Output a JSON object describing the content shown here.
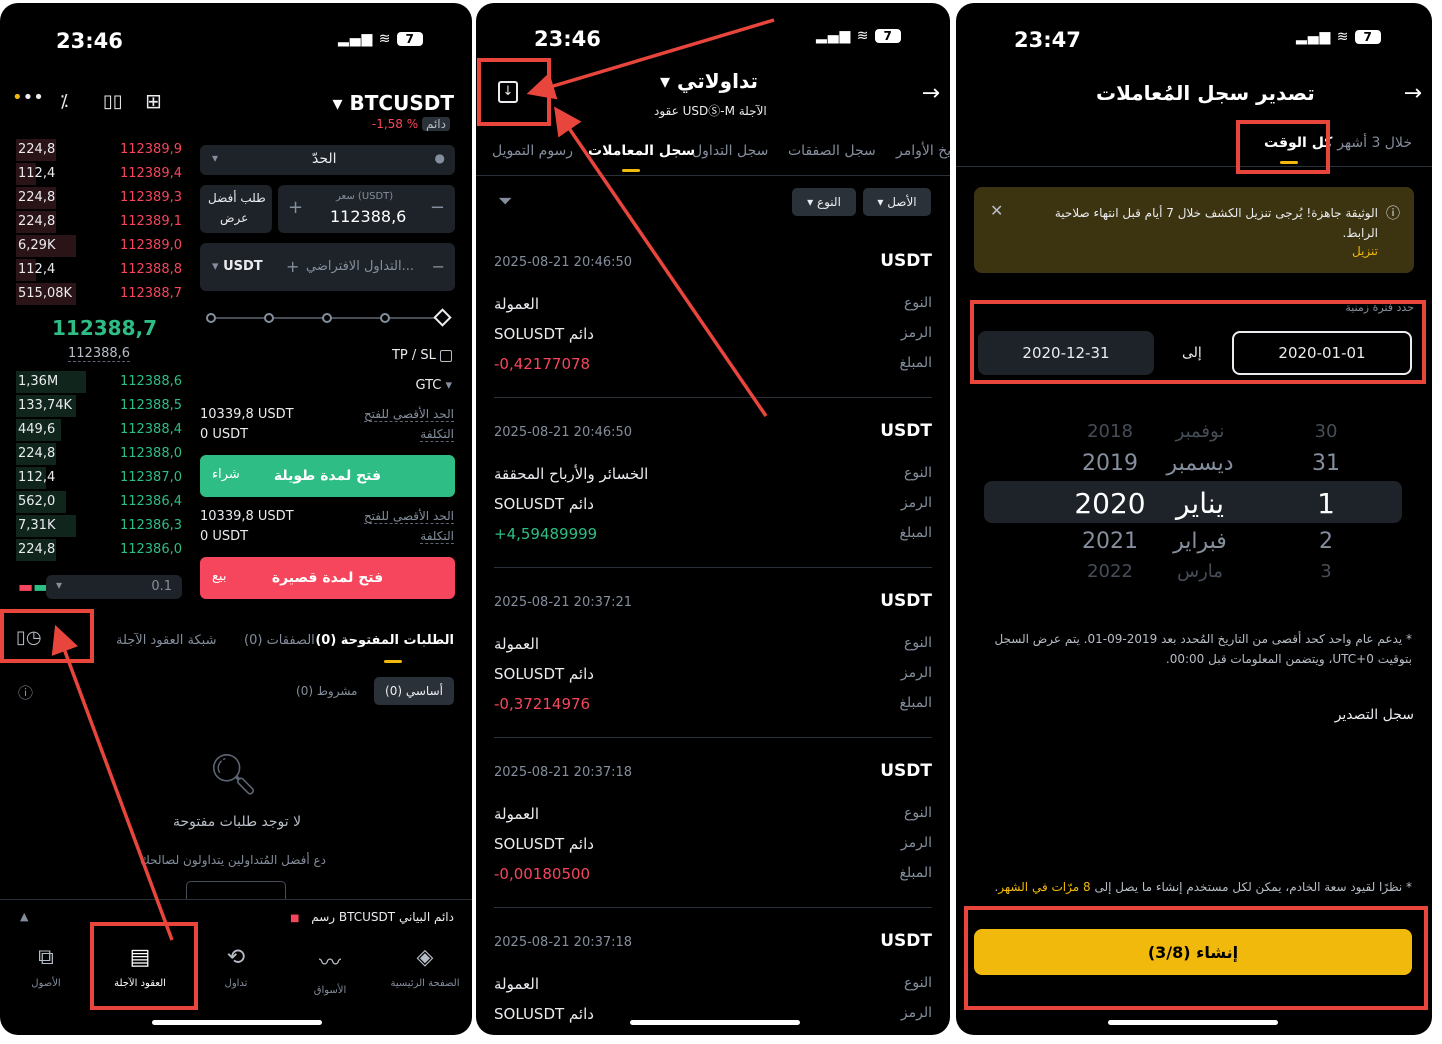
{
  "status": {
    "time1": "23:46",
    "time2": "23:46",
    "time3": "23:47",
    "battery": "7"
  },
  "p1": {
    "symbol": "BTCUSDT",
    "perp": "دائم",
    "change": "-1,58 %",
    "asks": [
      {
        "q": "224,8",
        "p": "112389,9"
      },
      {
        "q": "112,4",
        "p": "112389,4"
      },
      {
        "q": "224,8",
        "p": "112389,3"
      },
      {
        "q": "224,8",
        "p": "112389,1"
      },
      {
        "q": "6,29K",
        "p": "112389,0"
      },
      {
        "q": "112,4",
        "p": "112388,8"
      },
      {
        "q": "515,08K",
        "p": "112388,7"
      }
    ],
    "mid_price": "112388,7",
    "mark_price": "112388,6",
    "bids": [
      {
        "q": "1,36M",
        "p": "112388,6"
      },
      {
        "q": "133,74K",
        "p": "112388,5"
      },
      {
        "q": "449,6",
        "p": "112388,4"
      },
      {
        "q": "224,8",
        "p": "112388,0"
      },
      {
        "q": "112,4",
        "p": "112387,0"
      },
      {
        "q": "562,0",
        "p": "112386,4"
      },
      {
        "q": "7,31K",
        "p": "112386,3"
      },
      {
        "q": "224,8",
        "p": "112386,0"
      }
    ],
    "depth_step": "0.1",
    "order_type": "الحدّ",
    "bbo_top": "طلب أفضل",
    "bbo_bottom": "عرض",
    "price_label": "سعر (USDT)",
    "price_value": "112388,6",
    "amount_placeholder": "التداول الافتراضي...",
    "amount_unit": "USDT",
    "tpsl": "TP / SL",
    "gtc": "GTC",
    "max_open_label": "الحد الأقصى للفتح",
    "cost_label": "التكلفة",
    "max_open_long": "10339,8 USDT",
    "cost_long": "0 USDT",
    "long_btn": "فتح لمدة طويلة",
    "long_side": "شراء",
    "max_open_short": "10339,8 USDT",
    "cost_short": "0 USDT",
    "short_btn": "فتح لمدة قصيرة",
    "short_side": "بيع",
    "tabs": [
      "الطلبات المفتوحة (0)",
      "الصفقات (0)",
      "شبكة العقود الآجلة"
    ],
    "sub_basic": "أساسي (0)",
    "sub_cond": "مشروط (0)",
    "empty_title": "لا توجد طلبات مفتوحة",
    "empty_sub": "دع أفضل المُتداولين يتداولون لصالحك",
    "chart_bar": "رسم BTCUSDT دائم البياني",
    "nav": [
      "الأصول",
      "العقود الآجلة",
      "تداول",
      "الأسواق",
      "الصفحة الرئيسية"
    ]
  },
  "p2": {
    "title": "تداولاتي",
    "subtitle": "عقود USDⓈ-M الآجلة",
    "tabs": [
      "رسوم التمويل",
      "سجل المعاملات",
      "سجل التداول",
      "سجل الصفقات",
      "يخ الأوامر"
    ],
    "filter_asset": "الأصل",
    "filter_type": "النوع",
    "lbl_type": "النوع",
    "lbl_symbol": "الرمز",
    "lbl_amount": "المبلغ",
    "records": [
      {
        "date": "2025-08-21 20:46:50",
        "asset": "USDT",
        "type": "العمولة",
        "symbol": "SOLUSDT دائم",
        "amount": "-0,42177078",
        "pos": false
      },
      {
        "date": "2025-08-21 20:46:50",
        "asset": "USDT",
        "type": "الخسائر والأرباح المحققة",
        "symbol": "SOLUSDT دائم",
        "amount": "+4,59489999",
        "pos": true
      },
      {
        "date": "2025-08-21 20:37:21",
        "asset": "USDT",
        "type": "العمولة",
        "symbol": "SOLUSDT دائم",
        "amount": "-0,37214976",
        "pos": false
      },
      {
        "date": "2025-08-21 20:37:18",
        "asset": "USDT",
        "type": "العمولة",
        "symbol": "SOLUSDT دائم",
        "amount": "-0,00180500",
        "pos": false
      },
      {
        "date": "2025-08-21 20:37:18",
        "asset": "USDT",
        "type": "العمولة",
        "symbol": "SOLUSDT دائم",
        "amount": "",
        "pos": false
      }
    ]
  },
  "p3": {
    "title": "تصدير سجل المُعاملات",
    "tab_3m": "خلال 3 أشهر",
    "tab_all": "كل الوقت",
    "notice": "الوثيقة جاهزة! يُرجى تنزيل الكشف خلال 7 أيام قبل انتهاء صلاحية الرابط.",
    "notice_link": "تنزيل",
    "range_label": "حدد فترة زمنية",
    "from": "2020-01-01",
    "to_word": "إلى",
    "to": "2020-12-31",
    "picker": [
      {
        "y": "2018",
        "m": "نوفمبر",
        "d": "30"
      },
      {
        "y": "2019",
        "m": "ديسمبر",
        "d": "31"
      },
      {
        "y": "2020",
        "m": "يناير",
        "d": "1"
      },
      {
        "y": "2021",
        "m": "فبراير",
        "d": "2"
      },
      {
        "y": "2022",
        "m": "مارس",
        "d": "3"
      }
    ],
    "note": "* يدعم عام واحد كحد أقصى من التاريخ المُحدد بعد 2019-09-01. يتم عرض السجل بتوقيت UTC+0، ويتضمن المعلومات قبل 00:00.",
    "export_history": "سجل التصدير",
    "limit_note": "* نظرًا لقيود سعة الخادم، يمكن لكل مستخدم إنشاء ما يصل إلى",
    "limit_hl": "8 مرّات في الشهر",
    "create_btn": "إنشاء (3/8)"
  },
  "colors": {
    "red": "#f6465d",
    "green": "#2ebd85",
    "yellow": "#f0b90b",
    "annotation": "#e8453c"
  }
}
